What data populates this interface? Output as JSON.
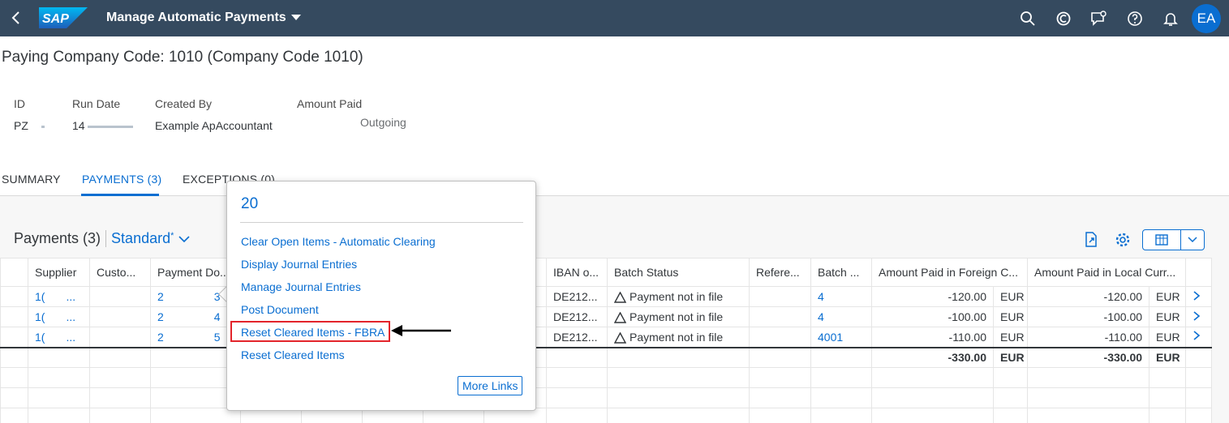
{
  "shell": {
    "title": "Manage Automatic Payments",
    "logo_text": "SAP",
    "avatar": "EA",
    "icons": [
      "search-icon",
      "co-pilot-icon",
      "notification-chat-icon",
      "help-icon",
      "bell-icon"
    ]
  },
  "page": {
    "title": "Paying Company Code: 1010 (Company Code 1010)"
  },
  "header": {
    "id_label": "ID",
    "id_value": "PZ",
    "run_date_label": "Run Date",
    "run_date_value": "14",
    "created_by_label": "Created By",
    "created_by_value": "Example ApAccountant",
    "amount_paid_label": "Amount Paid",
    "amount_paid_value": "Outgoing"
  },
  "tabs": [
    "SUMMARY",
    "PAYMENTS (3)",
    "EXCEPTIONS (0)"
  ],
  "table": {
    "title": "Payments (3)",
    "variant": "Standard",
    "variant_modified": "*",
    "columns": [
      "",
      "Supplier",
      "Custo...",
      "Payment Do...",
      "",
      "",
      "",
      "",
      "",
      "IBAN o...",
      "Batch Status",
      "Refere...",
      "Batch ...",
      "Amount Paid in Foreign C...",
      "",
      "Amount Paid in Local Curr...",
      "",
      ""
    ],
    "rows": [
      {
        "supplier": "1(",
        "supplier2": "...",
        "pay1": "2",
        "pay2": "3",
        "iban": "DE212...",
        "status": "Payment not in file",
        "batch": "4",
        "foreign": "-120.00",
        "fcur": "EUR",
        "local": "-120.00",
        "lcur": "EUR"
      },
      {
        "supplier": "1(",
        "supplier2": "...",
        "pay1": "2",
        "pay2": "4",
        "iban": "DE212...",
        "status": "Payment not in file",
        "batch": "4",
        "foreign": "-100.00",
        "fcur": "EUR",
        "local": "-100.00",
        "lcur": "EUR"
      },
      {
        "supplier": "1(",
        "supplier2": "...",
        "pay1": "2",
        "pay2": "5",
        "iban": "DE212...",
        "status": "Payment not in file",
        "batch": "4001",
        "foreign": "-110.00",
        "fcur": "EUR",
        "local": "-110.00",
        "lcur": "EUR"
      }
    ],
    "total": {
      "foreign": "-330.00",
      "fcur": "EUR",
      "local": "-330.00",
      "lcur": "EUR"
    }
  },
  "popover": {
    "title": "20",
    "links": [
      "Clear Open Items - Automatic Clearing",
      "Display Journal Entries",
      "Manage Journal Entries",
      "Post Document",
      "Reset Cleared Items - FBRA",
      "Reset Cleared Items"
    ],
    "more_links": "More Links"
  },
  "colors": {
    "shell": "#354a5f",
    "link": "#0a6ed1",
    "highlight": "#e3242b"
  }
}
